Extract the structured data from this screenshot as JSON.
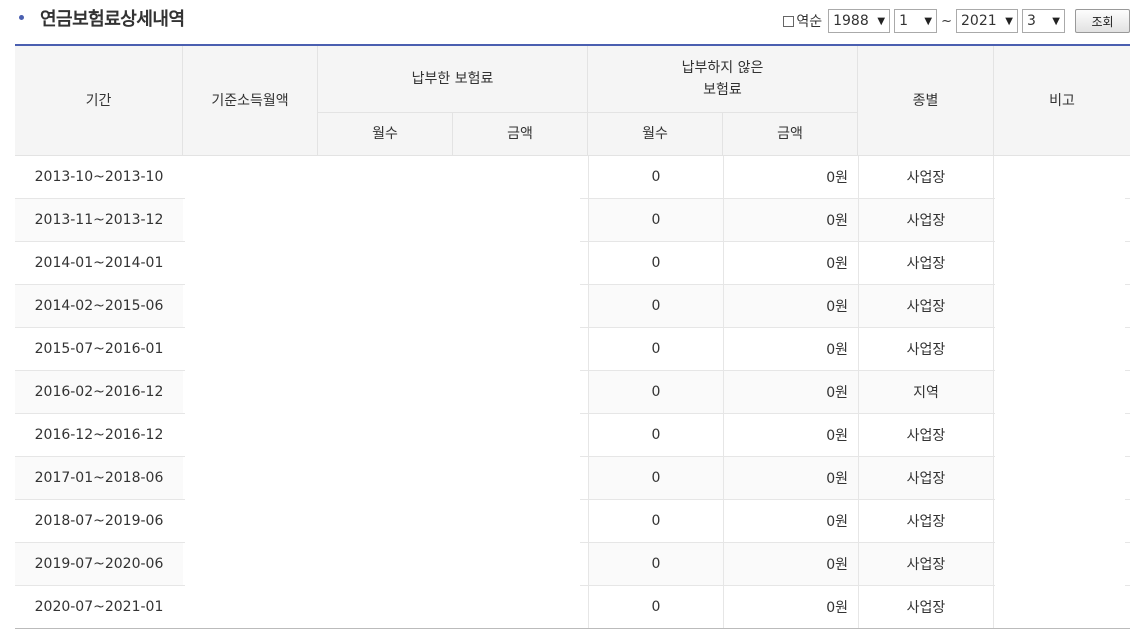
{
  "title": "연금보험료상세내역",
  "controls": {
    "reverse_label": "역순",
    "from_year": "1988",
    "from_month": "1",
    "separator": "~",
    "to_year": "2021",
    "to_month": "3",
    "search_button": "조회"
  },
  "headers": {
    "period": "기간",
    "base_income": "기준소득월액",
    "paid": "납부한 보험료",
    "unpaid_line1": "납부하지 않은",
    "unpaid_line2": "보험료",
    "type": "종별",
    "note": "비고",
    "months": "월수",
    "amount": "금액"
  },
  "rows": [
    {
      "period": "2013-10~2013-10",
      "unpaid_months": "0",
      "unpaid_amount": "0원",
      "type": "사업장"
    },
    {
      "period": "2013-11~2013-12",
      "unpaid_months": "0",
      "unpaid_amount": "0원",
      "type": "사업장"
    },
    {
      "period": "2014-01~2014-01",
      "unpaid_months": "0",
      "unpaid_amount": "0원",
      "type": "사업장"
    },
    {
      "period": "2014-02~2015-06",
      "unpaid_months": "0",
      "unpaid_amount": "0원",
      "type": "사업장"
    },
    {
      "period": "2015-07~2016-01",
      "unpaid_months": "0",
      "unpaid_amount": "0원",
      "type": "사업장"
    },
    {
      "period": "2016-02~2016-12",
      "unpaid_months": "0",
      "unpaid_amount": "0원",
      "type": "지역"
    },
    {
      "period": "2016-12~2016-12",
      "unpaid_months": "0",
      "unpaid_amount": "0원",
      "type": "사업장"
    },
    {
      "period": "2017-01~2018-06",
      "unpaid_months": "0",
      "unpaid_amount": "0원",
      "type": "사업장"
    },
    {
      "period": "2018-07~2019-06",
      "unpaid_months": "0",
      "unpaid_amount": "0원",
      "type": "사업장"
    },
    {
      "period": "2019-07~2020-06",
      "unpaid_months": "0",
      "unpaid_amount": "0원",
      "type": "사업장"
    },
    {
      "period": "2020-07~2021-01",
      "unpaid_months": "0",
      "unpaid_amount": "0원",
      "type": "사업장"
    }
  ]
}
